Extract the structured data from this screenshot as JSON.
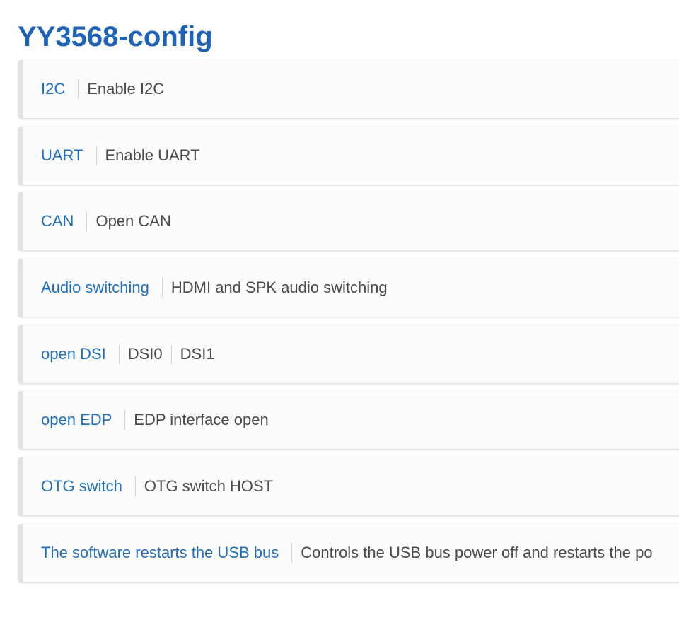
{
  "page": {
    "title": "YY3568-config"
  },
  "items": [
    {
      "label": "I2C",
      "values": [
        "Enable I2C"
      ]
    },
    {
      "label": "UART",
      "values": [
        "Enable UART"
      ]
    },
    {
      "label": "CAN",
      "values": [
        "Open CAN"
      ]
    },
    {
      "label": "Audio switching",
      "values": [
        "HDMI and SPK audio switching"
      ]
    },
    {
      "label": "open DSI",
      "values": [
        "DSI0",
        "DSI1"
      ]
    },
    {
      "label": "open EDP",
      "values": [
        "EDP interface open"
      ]
    },
    {
      "label": "OTG switch",
      "values": [
        "OTG switch HOST"
      ]
    },
    {
      "label": "The software restarts the USB bus",
      "values": [
        "Controls the USB bus power off and restarts the po"
      ]
    }
  ]
}
